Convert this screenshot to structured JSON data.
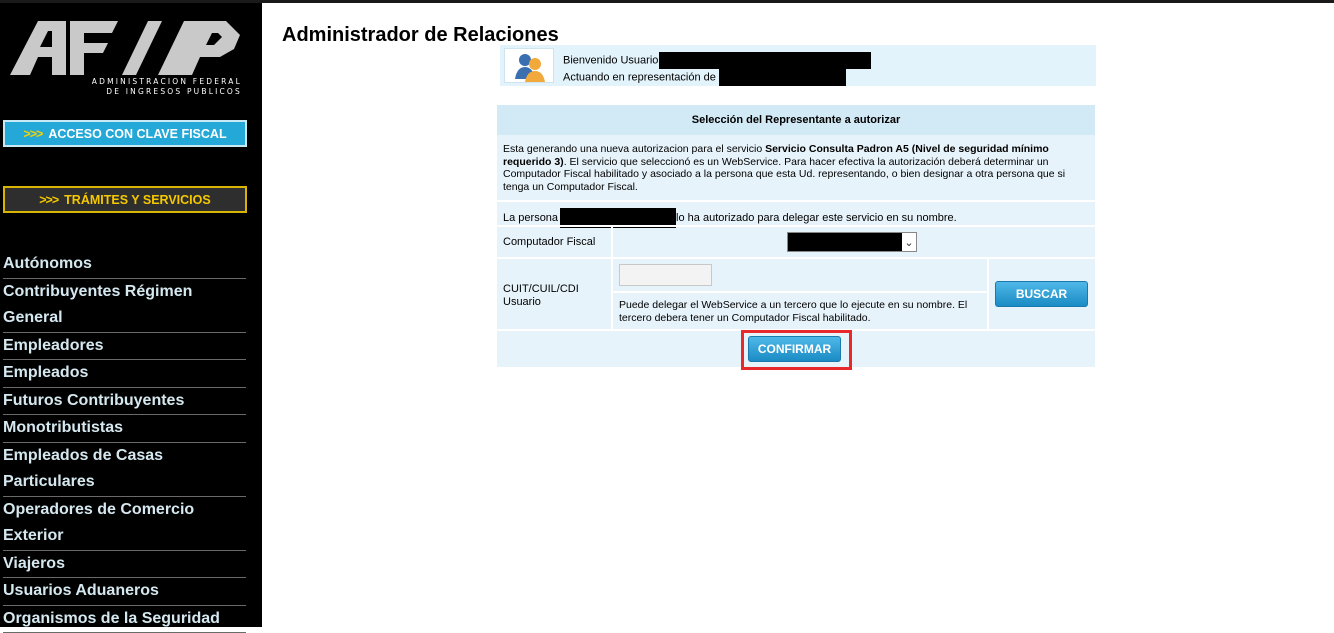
{
  "logo": {
    "line1": "ADMINISTRACION FEDERAL",
    "line2": "DE INGRESOS PUBLICOS"
  },
  "sidebar": {
    "clave_fiscal_button": ">>> ACCESO CON CLAVE FISCAL",
    "clave_fiscal_arrow": ">>>",
    "clave_fiscal_text": "ACCESO CON CLAVE FISCAL",
    "tramites_arrow": ">>>",
    "tramites_text": "TRÁMITES Y SERVICIOS",
    "menu": [
      "Autónomos",
      "Contribuyentes Régimen General",
      "Empleadores",
      "Empleados",
      "Futuros Contribuyentes",
      "Monotributistas",
      "Empleados de Casas Particulares",
      "Operadores de Comercio Exterior",
      "Viajeros",
      "Usuarios Aduaneros",
      "Organismos de la Seguridad"
    ]
  },
  "page": {
    "title": "Administrador de Relaciones"
  },
  "welcome": {
    "user_label": "Bienvenido Usuario",
    "representation_label": "Actuando en representación de"
  },
  "form": {
    "section_title": "Selección del Representante a autorizar",
    "desc_part1": "Esta generando una nueva autorizacion para el servicio ",
    "desc_bold": "Servicio Consulta Padron A5 (Nivel de seguridad mínimo requerido 3)",
    "desc_part2": ". El servicio que seleccionó es un WebService. Para hacer efectiva la autorización deberá determinar un Computador Fiscal habilitado y asociado a la persona que esta Ud. representando, o bien designar a otra persona que si tenga un Computador Fiscal.",
    "persona_prefix": "La persona",
    "persona_suffix": "lo ha autorizado para delegar este servicio en su nombre.",
    "computador_label": "Computador Fiscal",
    "cuit_label": "CUIT/CUIL/CDI Usuario",
    "cuit_value": "",
    "note": "Puede delegar el WebService a un tercero que lo ejecute en su nombre. El tercero debera tener un Computador Fiscal habilitado.",
    "buscar_button": "BUSCAR",
    "confirmar_button": "CONFIRMAR"
  }
}
